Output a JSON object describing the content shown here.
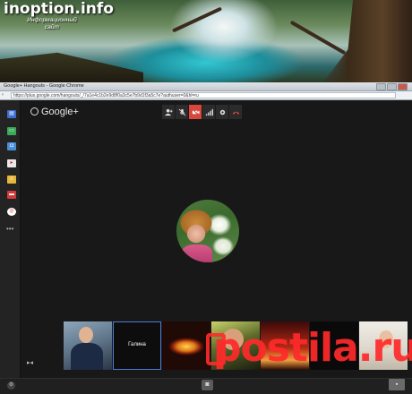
{
  "site": {
    "title": "inoption.info",
    "tagline": "Информационный сайт"
  },
  "browser": {
    "window_title": "Google+ Hangouts - Google Chrome",
    "url": "https://plus.google.com/hangouts/_/7a1e4c1b2e9d8f0a3c5e7b9d1f3a5c7e?authuser=0&hl=ru"
  },
  "hangout": {
    "logo_text": "Google+",
    "toolbar_icons": [
      "invite-people-icon",
      "mute-mic-icon",
      "camera-off-icon",
      "bandwidth-icon",
      "settings-icon",
      "hangup-icon"
    ],
    "participant_name": "Галина",
    "app_icons": [
      "chat-icon",
      "screenshare-icon",
      "capture-icon",
      "youtube-icon",
      "effects-icon",
      "remote-desktop-icon",
      "help-icon"
    ],
    "watermark_text": "postila.ru"
  },
  "colors": {
    "accent_red": "#d9473c",
    "background": "#181818",
    "watermark": "#ff2a2a"
  }
}
